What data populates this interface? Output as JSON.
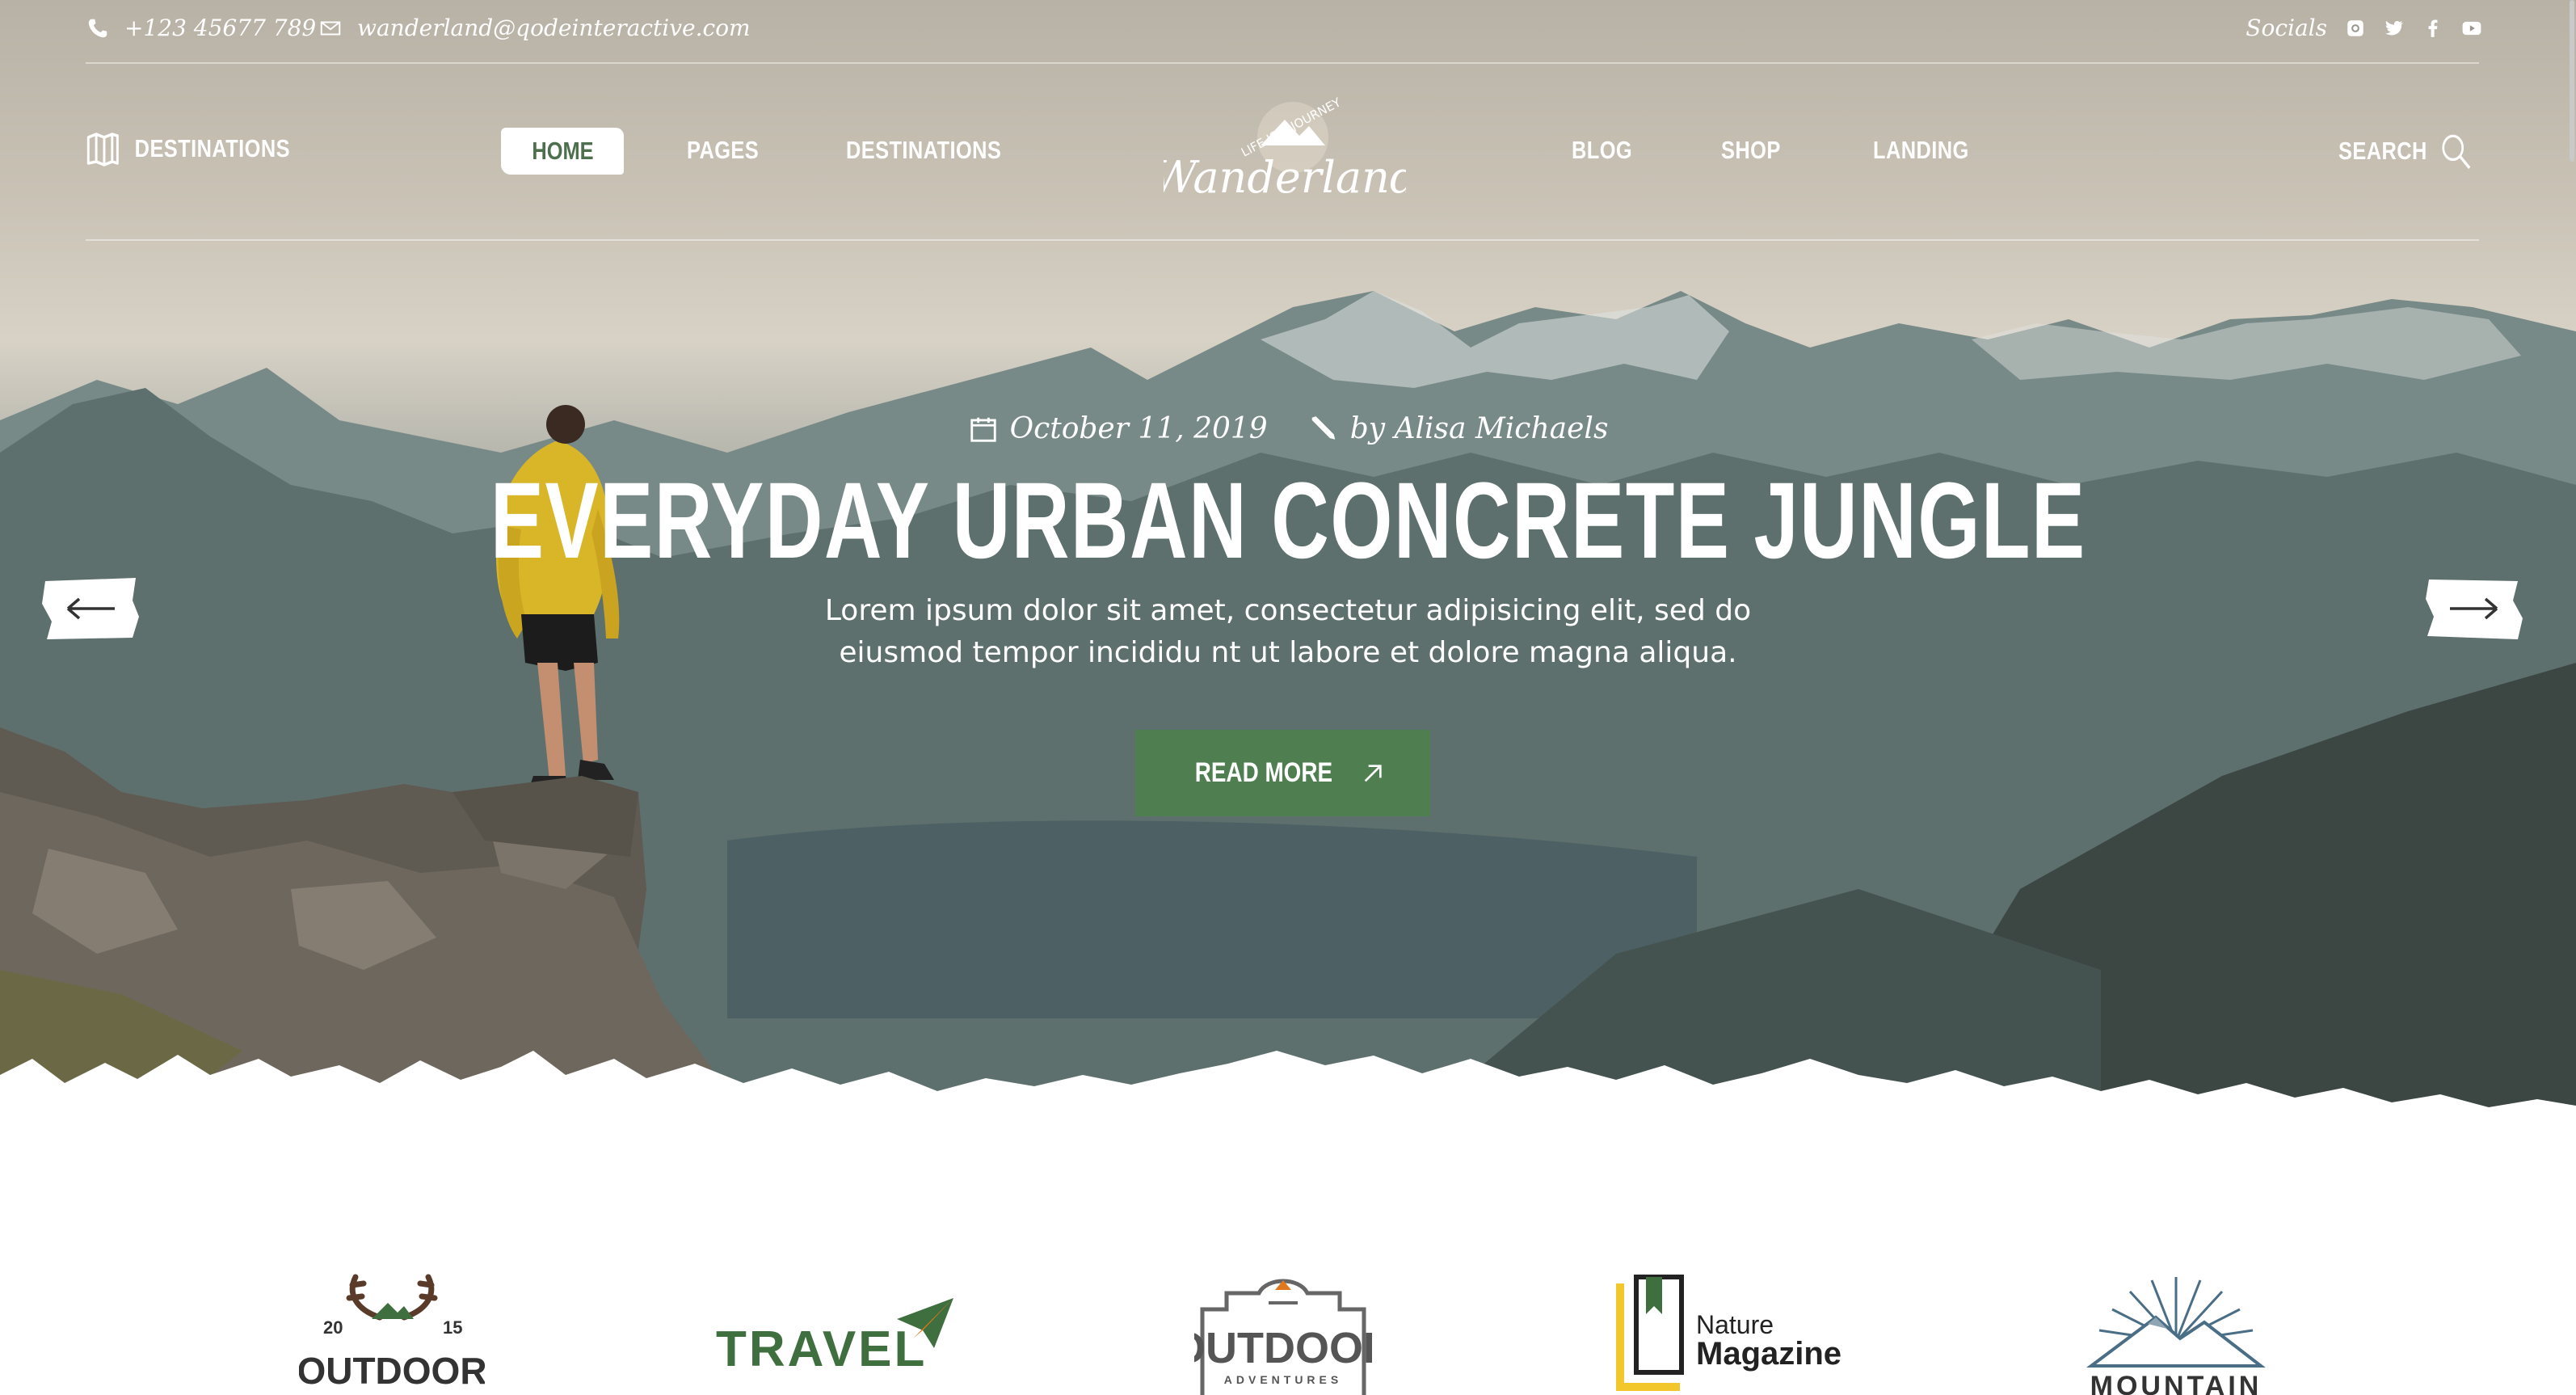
{
  "topbar": {
    "phone": "+123 45677 789",
    "email": "wanderland@qodeinteractive.com",
    "socials_label": "Socials",
    "social_icons": [
      "instagram-icon",
      "twitter-icon",
      "facebook-icon",
      "youtube-icon"
    ]
  },
  "nav": {
    "left_label": "DESTINATIONS",
    "items": [
      "HOME",
      "PAGES",
      "DESTINATIONS",
      "BLOG",
      "SHOP",
      "LANDING"
    ],
    "active": "HOME",
    "search_label": "SEARCH"
  },
  "logo": {
    "name": "Wanderland",
    "tagline": "LIFE IS A JOURNEY"
  },
  "hero": {
    "date": "October 11, 2019",
    "author": "by Alisa Michaels",
    "title": "EVERYDAY URBAN CONCRETE JUNGLE",
    "excerpt_line1": "Lorem ipsum dolor sit amet, consectetur adipisicing elit, sed do",
    "excerpt_line2": "eiusmod tempor incididu nt ut labore et dolore magna aliqua.",
    "button_label": "READ MORE"
  },
  "brands": [
    {
      "name": "OUTDOOR",
      "year_left": "20",
      "year_right": "15"
    },
    {
      "name": "TRAVEL"
    },
    {
      "name": "OUTDOOR",
      "sub": "ADVENTURES"
    },
    {
      "name_top": "Nature",
      "name_bottom": "Magazine"
    },
    {
      "name": "MOUNTAIN"
    }
  ],
  "colors": {
    "accent_green": "#4f7f50",
    "brand_green": "#3f6f3f",
    "brand_orange": "#e0781e",
    "brand_yellow": "#f2c72c",
    "brand_brown": "#5a3b2a"
  }
}
